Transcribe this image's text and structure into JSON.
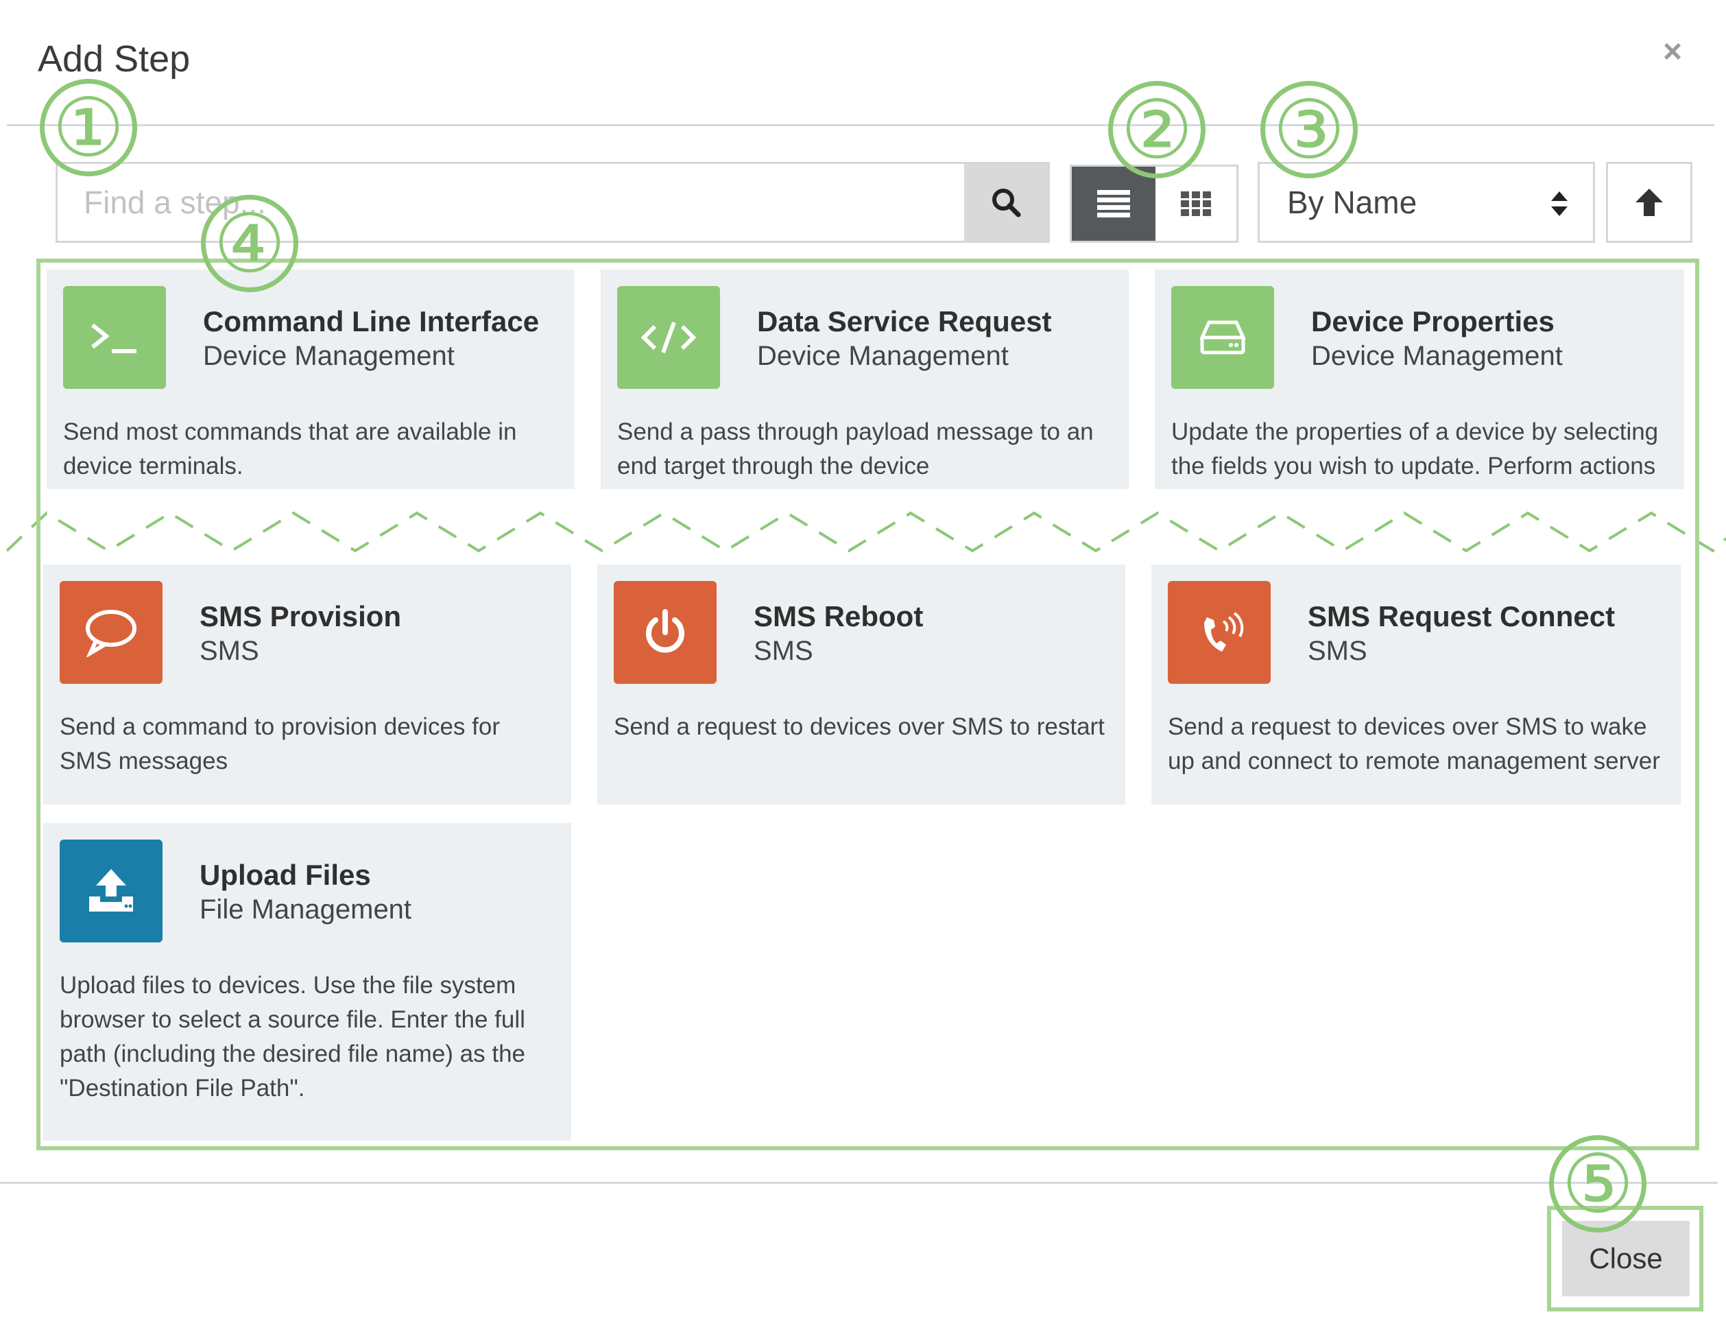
{
  "dialog": {
    "title": "Add Step",
    "close_symbol": "×"
  },
  "toolbar": {
    "search_placeholder": "Find a step...",
    "search_icon": "search-icon",
    "list_view_icon": "list-icon",
    "grid_view_icon": "grid-icon",
    "list_view_active": true,
    "sort_selected": "By Name",
    "sort_direction_icon": "arrow-up-icon"
  },
  "annotations": [
    "①",
    "②",
    "③",
    "④",
    "⑤"
  ],
  "annotation_color": "#8cc876",
  "steps": [
    {
      "title": "Command Line Interface",
      "category": "Device Management",
      "description": "Send most commands that are available in device terminals.",
      "icon": "terminal-icon",
      "color": "#8cc876"
    },
    {
      "title": "Data Service Request",
      "category": "Device Management",
      "description": "Send a pass through payload message to an end target through the device",
      "icon": "code-icon",
      "color": "#8cc876"
    },
    {
      "title": "Device Properties",
      "category": "Device Management",
      "description": "Update the properties of a device by selecting the fields you wish to update. Perform actions",
      "icon": "hard-drive-icon",
      "color": "#8cc876"
    },
    {
      "title": "SMS Provision",
      "category": "SMS",
      "description": "Send a command to provision devices for SMS messages",
      "icon": "speech-bubble-icon",
      "color": "#d9623b"
    },
    {
      "title": "SMS Reboot",
      "category": "SMS",
      "description": "Send a request to devices over SMS to restart",
      "icon": "power-icon",
      "color": "#d9623b"
    },
    {
      "title": "SMS Request Connect",
      "category": "SMS",
      "description": "Send a request to devices over SMS to wake up and connect to remote management server",
      "icon": "phone-ringing-icon",
      "color": "#d9623b"
    },
    {
      "title": "Upload Files",
      "category": "File Management",
      "description": "Upload files to devices. Use the file system browser to select a source file. Enter the full path (including the desired file name) as the \"Destination File Path\".",
      "icon": "upload-icon",
      "color": "#1a7ea8"
    }
  ],
  "footer": {
    "close_label": "Close"
  }
}
